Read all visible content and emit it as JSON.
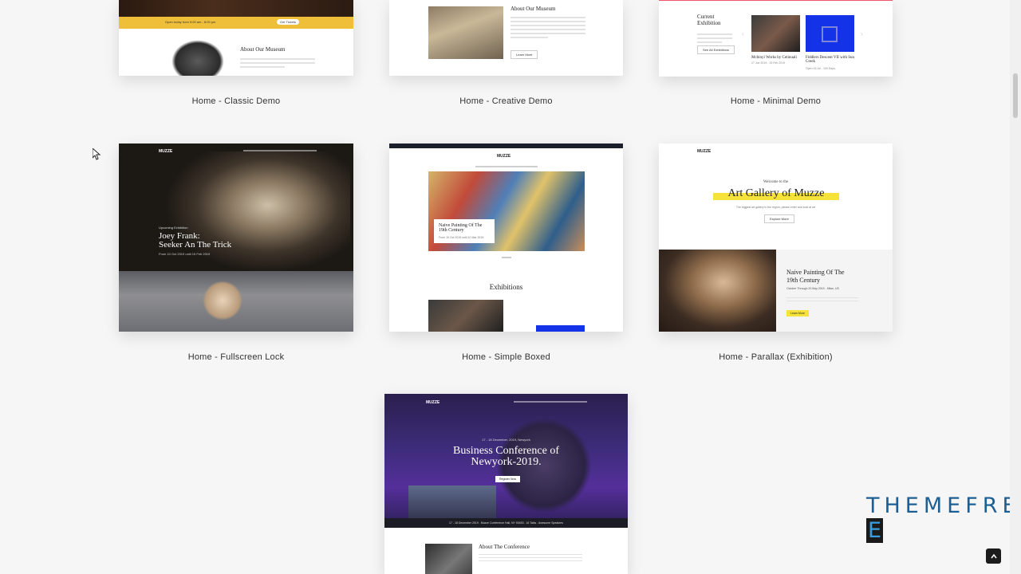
{
  "demos": [
    {
      "label": "Home - Classic Demo",
      "heading": "About Our Museum",
      "banner": "Open today from 9:00 am - 8:00 pm",
      "banner_btn": "Get Tickets"
    },
    {
      "label": "Home - Creative Demo",
      "heading": "About Our Museum",
      "btn": "Learn More"
    },
    {
      "label": "Home - Minimal Demo",
      "heading": "Current Exhibition",
      "btn": "See All Exhibitions",
      "artworks": [
        {
          "title": "Mcbinyi Works by Cetinuali",
          "date": "17 Jun 2019 - 15 Feb 2019"
        },
        {
          "title": "Fiddlers Descent VII with Sun Creek",
          "date": "Open 15 Jul - 100 Days"
        }
      ]
    },
    {
      "label": "Home - Fullscreen Lock",
      "kicker": "Upcoming Exhibition",
      "title_line1": "Joey Frank:",
      "title_line2": "Seeker An The Trick",
      "date": "From 10 Oct 2019 until 15 Feb 2019"
    },
    {
      "label": "Home - Simple Boxed",
      "caption_title_line1": "Naive Painting Of The",
      "caption_title_line2": "19th Century",
      "caption_date": "From 10 Oct 2019 until 10 Mar 2019",
      "section": "Exhibitions"
    },
    {
      "label": "Home - Parallax (Exhibition)",
      "welcome": "Welcome to the",
      "title": "Art Gallery of Muzze",
      "subtitle": "The biggest art gallery in the region, please enter and look at art",
      "btn": "Explore More",
      "panel_title_line1": "Naive Painting Of The",
      "panel_title_line2": "19th Century",
      "panel_meta": "October Through 20 May 2019 - Milan, US",
      "panel_btn": "Learn More"
    },
    {
      "label": "",
      "date": "17 - 18 December, 2019, Newyork",
      "title_line1": "Business Conference of",
      "title_line2": "Newyork-2019.",
      "btn": "Register Now",
      "strip": "17 - 18 December 2019 . Muzze Conference Hall, NY 90453 . 16 Talks . Awesome Speakers",
      "heading": "About The Conference"
    }
  ],
  "brand": {
    "logo": "THEMEFRE",
    "logo_letter": "E",
    "museum_logo": "MUZZE"
  },
  "colors": {
    "accent": "#f0bf3a",
    "yellow": "#f7e23a",
    "dark": "#1a1a1a",
    "logo_blue": "#1d5f94"
  }
}
